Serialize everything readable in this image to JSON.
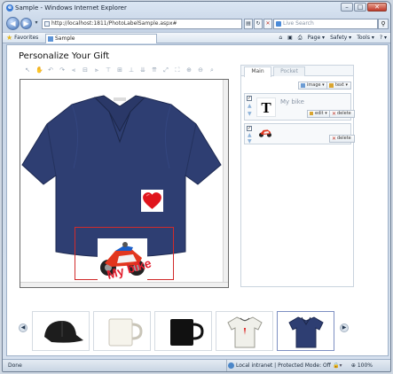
{
  "window": {
    "title": "Sample - Windows Internet Explorer",
    "controls": [
      "–",
      "□",
      "✕"
    ]
  },
  "address_bar": {
    "url": "http://localhost:1811/PhotoLabelSample.aspx#",
    "search_placeholder": "Live Search"
  },
  "command_bar": {
    "favorites": "Favorites",
    "tab_title": "Sample",
    "menus": [
      "Page ▾",
      "Safety ▾",
      "Tools ▾",
      "? ▾"
    ]
  },
  "page": {
    "title": "Personalize Your Gift",
    "design": {
      "text_item": "My bike"
    },
    "panel": {
      "tabs": [
        "Main",
        "Pocket"
      ],
      "add_image": "image ▾",
      "add_text": "text ▾",
      "layers": [
        {
          "checked": true,
          "thumb": "T",
          "text": "My bike",
          "edit": "edit ▾",
          "delete": "delete"
        },
        {
          "checked": true,
          "thumb": "motorbike",
          "text": "",
          "delete": "delete"
        }
      ]
    },
    "products": [
      {
        "name": "cap",
        "selected": false
      },
      {
        "name": "white-mug",
        "selected": false
      },
      {
        "name": "black-mug",
        "selected": false
      },
      {
        "name": "white-tshirt",
        "selected": false
      },
      {
        "name": "navy-polo",
        "selected": true
      }
    ]
  },
  "status_bar": {
    "left": "Done",
    "zone": "Local intranet | Protected Mode: Off",
    "zoom": "100%"
  },
  "colors": {
    "shirt": "#2e3e72",
    "selection": "#d12b2b",
    "text_item": "#e31e2e"
  }
}
